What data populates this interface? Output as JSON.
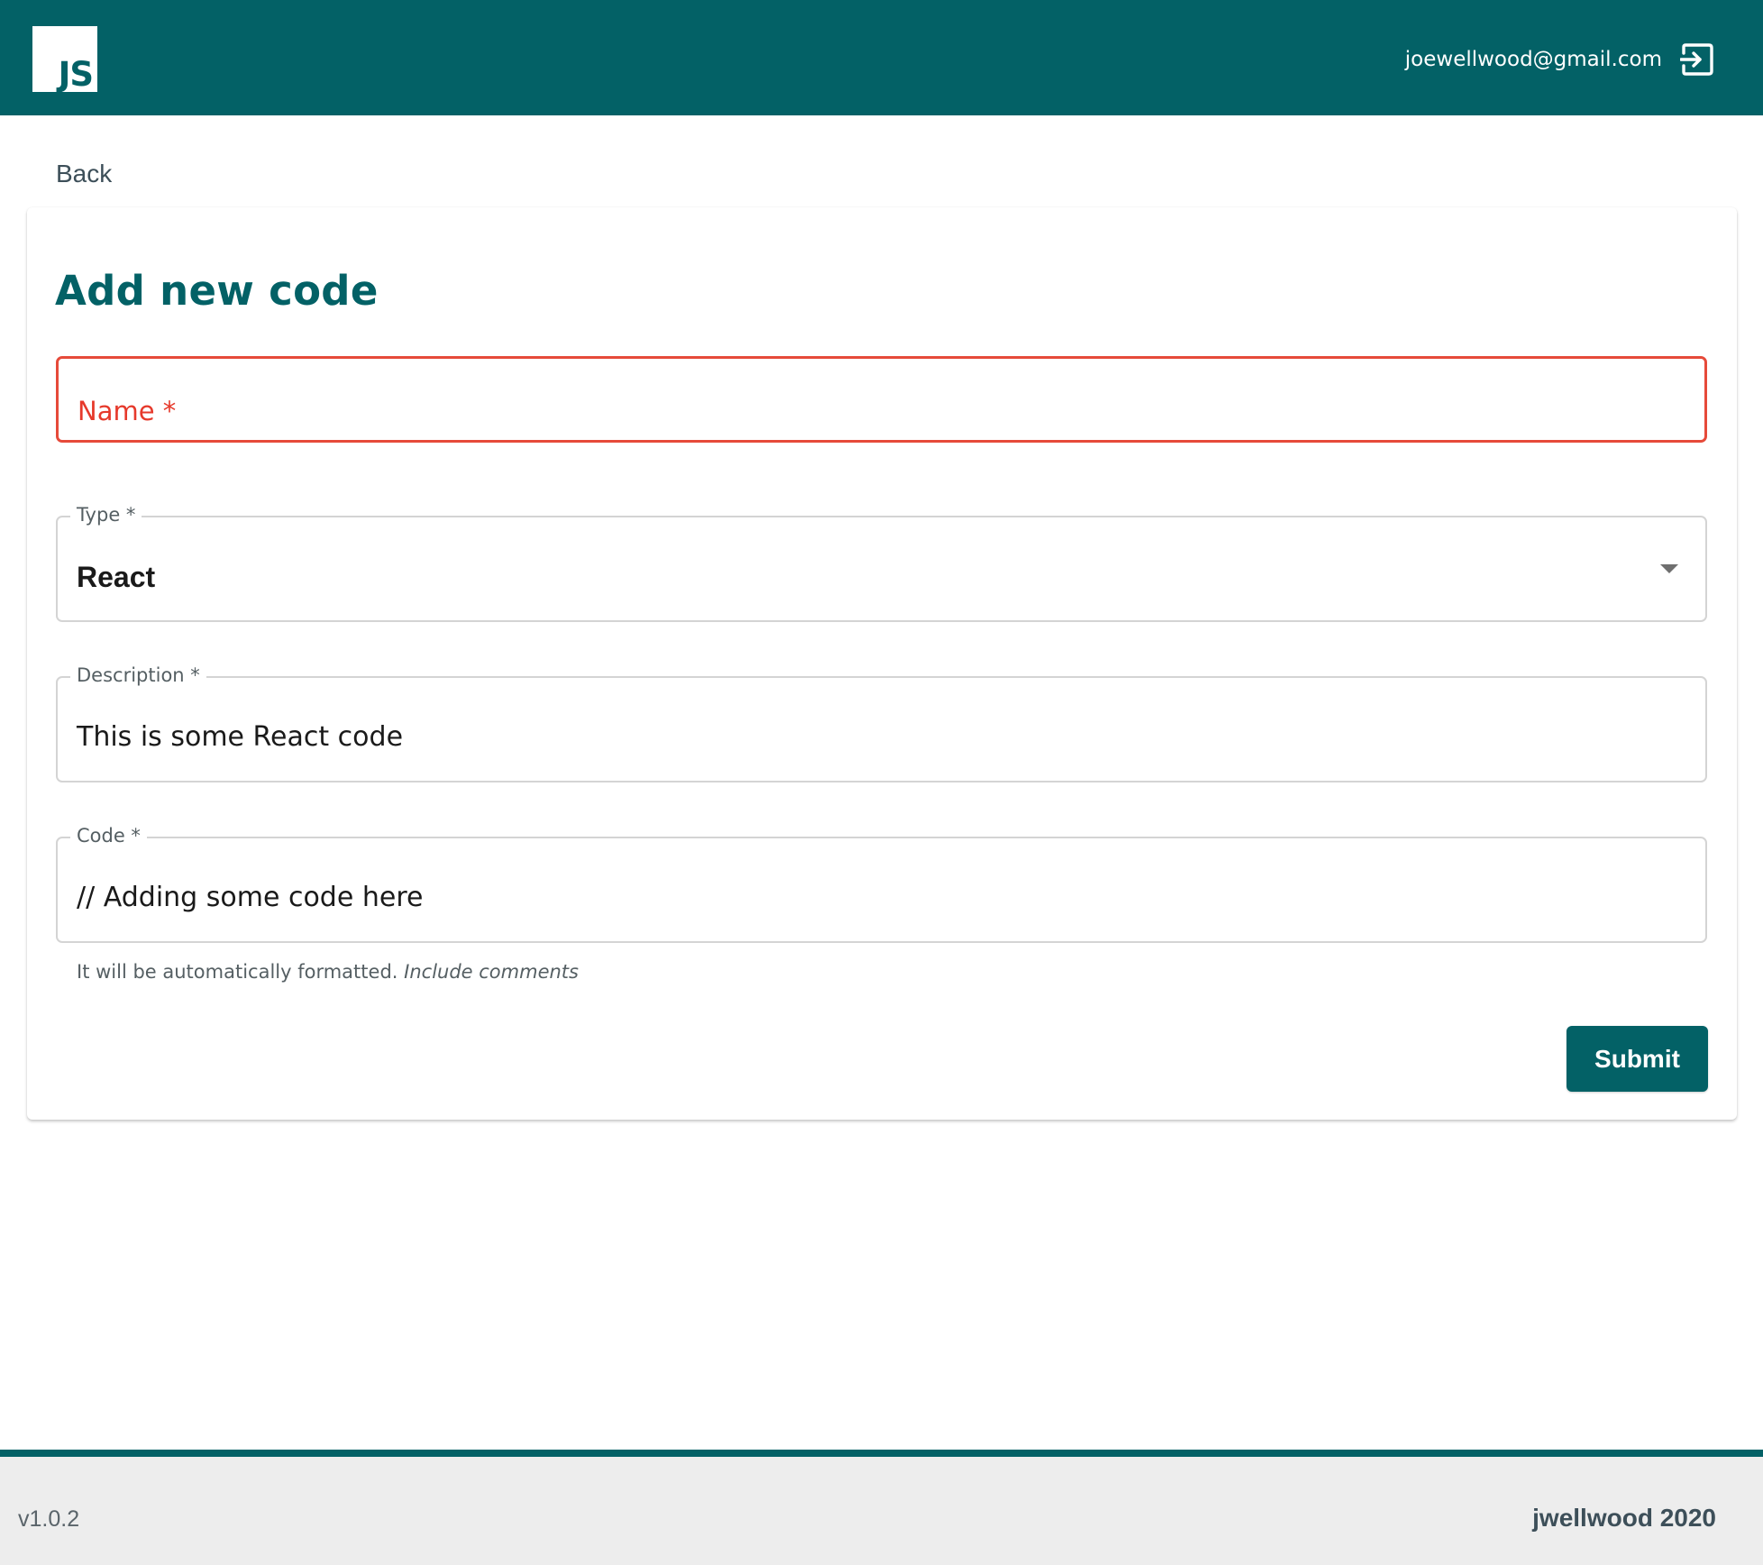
{
  "header": {
    "logo_text": "JS",
    "user_email": "joewellwood@gmail.com",
    "logout_icon": "logout-icon",
    "background_color": "#036166"
  },
  "nav": {
    "back_label": "Back"
  },
  "form": {
    "title": "Add new code",
    "name_field": {
      "label": "Name *",
      "value": "",
      "state": "error",
      "error_color": "#e6392b"
    },
    "type_field": {
      "label": "Type *",
      "selected": "React"
    },
    "description_field": {
      "label": "Description *",
      "value": "This is some React code"
    },
    "code_field": {
      "label": "Code *",
      "value": "// Adding some code here",
      "helper_text": "It will be automatically formatted.",
      "helper_emphasis": "Include comments"
    },
    "submit_label": "Submit"
  },
  "footer": {
    "version": "v1.0.2",
    "credit": "jwellwood 2020"
  }
}
